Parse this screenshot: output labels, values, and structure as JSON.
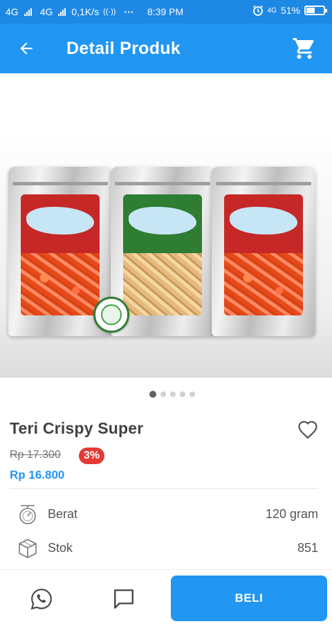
{
  "status_bar": {
    "network_1": "4G",
    "network_2": "4G",
    "speed": "0,1K/s",
    "overflow": "···",
    "time": "8:39 PM",
    "network_3": "4G",
    "battery": "51%",
    "battery_level": 0.51
  },
  "header": {
    "title": "Detail Produk",
    "back_icon": "arrow-left-icon",
    "cart_icon": "shopping-cart-icon"
  },
  "gallery": {
    "image_count": 5,
    "active_index": 0
  },
  "product": {
    "name": "Teri Crispy Super",
    "original_price": "Rp 17.300",
    "discount": "3%",
    "price": "Rp 16.800",
    "favorite_icon": "heart-outline-icon"
  },
  "specs": [
    {
      "icon": "scale-icon",
      "label": "Berat",
      "value": "120 gram"
    },
    {
      "icon": "box-icon",
      "label": "Stok",
      "value": "851"
    }
  ],
  "bottom_bar": {
    "whatsapp_icon": "whatsapp-icon",
    "chat_icon": "chat-bubble-icon",
    "buy_label": "BELI"
  },
  "colors": {
    "primary": "#2196f3",
    "status_bar": "#1e88e5",
    "discount_badge": "#e53935",
    "price": "#2196f3"
  }
}
